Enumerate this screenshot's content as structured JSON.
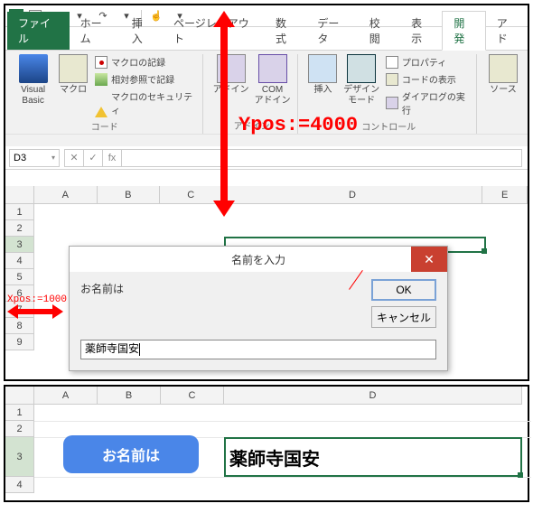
{
  "titlebar": {
    "qa_undo": "↶",
    "qa_redo": "↷",
    "qa_touch": "☝",
    "qa_dd": "▾"
  },
  "tabs": {
    "file": "ファイル",
    "home": "ホーム",
    "insert": "挿入",
    "pagelayout": "ページレイアウト",
    "formulas": "数式",
    "data": "データ",
    "review": "校閲",
    "view": "表示",
    "developer": "開発",
    "addins_partial": "アド"
  },
  "ribbon": {
    "visual_basic": "Visual Basic",
    "macros": "マクロ",
    "record_macro": "マクロの記録",
    "relative_ref": "相対参照で記録",
    "macro_security": "マクロのセキュリティ",
    "group_code": "コード",
    "addins": "アドイン",
    "com_addins": "COM\nアドイン",
    "group_addins": "アドイン",
    "insert_ctrl": "挿入",
    "design_mode": "デザイン\nモード",
    "properties": "プロパティ",
    "view_code": "コードの表示",
    "run_dialog": "ダイアログの実行",
    "group_controls": "コントロール",
    "source": "ソース"
  },
  "formula": {
    "namebox": "D3",
    "fx": "fx"
  },
  "grid": {
    "cols": [
      "A",
      "B",
      "C",
      "D",
      "E"
    ],
    "rows": [
      "1",
      "2",
      "3",
      "4",
      "5",
      "6",
      "7",
      "8",
      "9"
    ]
  },
  "annotation": {
    "ypos": "Ypos:=4000",
    "xpos": "Xpos:=1000"
  },
  "dialog": {
    "title": "名前を入力",
    "prompt": "お名前は",
    "ok": "OK",
    "cancel": "キャンセル",
    "input_value": "薬師寺国安"
  },
  "lower": {
    "cols": [
      "A",
      "B",
      "C",
      "D"
    ],
    "rows": [
      "1",
      "2",
      "3",
      "4"
    ],
    "shape_text": "お名前は",
    "cell_value": "薬師寺国安"
  }
}
